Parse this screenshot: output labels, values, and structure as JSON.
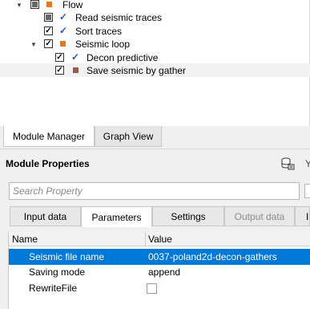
{
  "tree": {
    "items": [
      {
        "label": "Flow",
        "icon": "orange-square-icon"
      },
      {
        "label": "Read seismic traces",
        "icon": "blue-check-icon"
      },
      {
        "label": "Sort traces",
        "icon": "blue-check-icon"
      },
      {
        "label": "Seismic loop",
        "icon": "orange-square-icon"
      },
      {
        "label": "Decon predictive",
        "icon": "blue-check-icon"
      },
      {
        "label": "Save seismic by gather",
        "icon": "brown-square-icon"
      }
    ]
  },
  "bottom_tabs": {
    "module_manager": "Module Manager",
    "graph_view": "Graph View"
  },
  "module_properties": {
    "title": "Module Properties",
    "truncated_label": "Y",
    "search": {
      "placeholder": "Search Property",
      "value": ""
    },
    "tabs": {
      "input_data": "Input data",
      "parameters": "Parameters",
      "settings": "Settings",
      "output_data": "Output data",
      "truncated": "I"
    },
    "table": {
      "headers": {
        "name": "Name",
        "value": "Value"
      },
      "rows": [
        {
          "name": "Seismic file name",
          "value": "0037-poland2d-decon-gathers"
        },
        {
          "name": "Saving mode",
          "value": "append"
        },
        {
          "name": "RewriteFile",
          "value": ""
        }
      ]
    }
  },
  "colors": {
    "selection": "#0078d7",
    "orange": "#e8761e",
    "brown": "#a0584a",
    "blue_check": "#2a55b8"
  }
}
